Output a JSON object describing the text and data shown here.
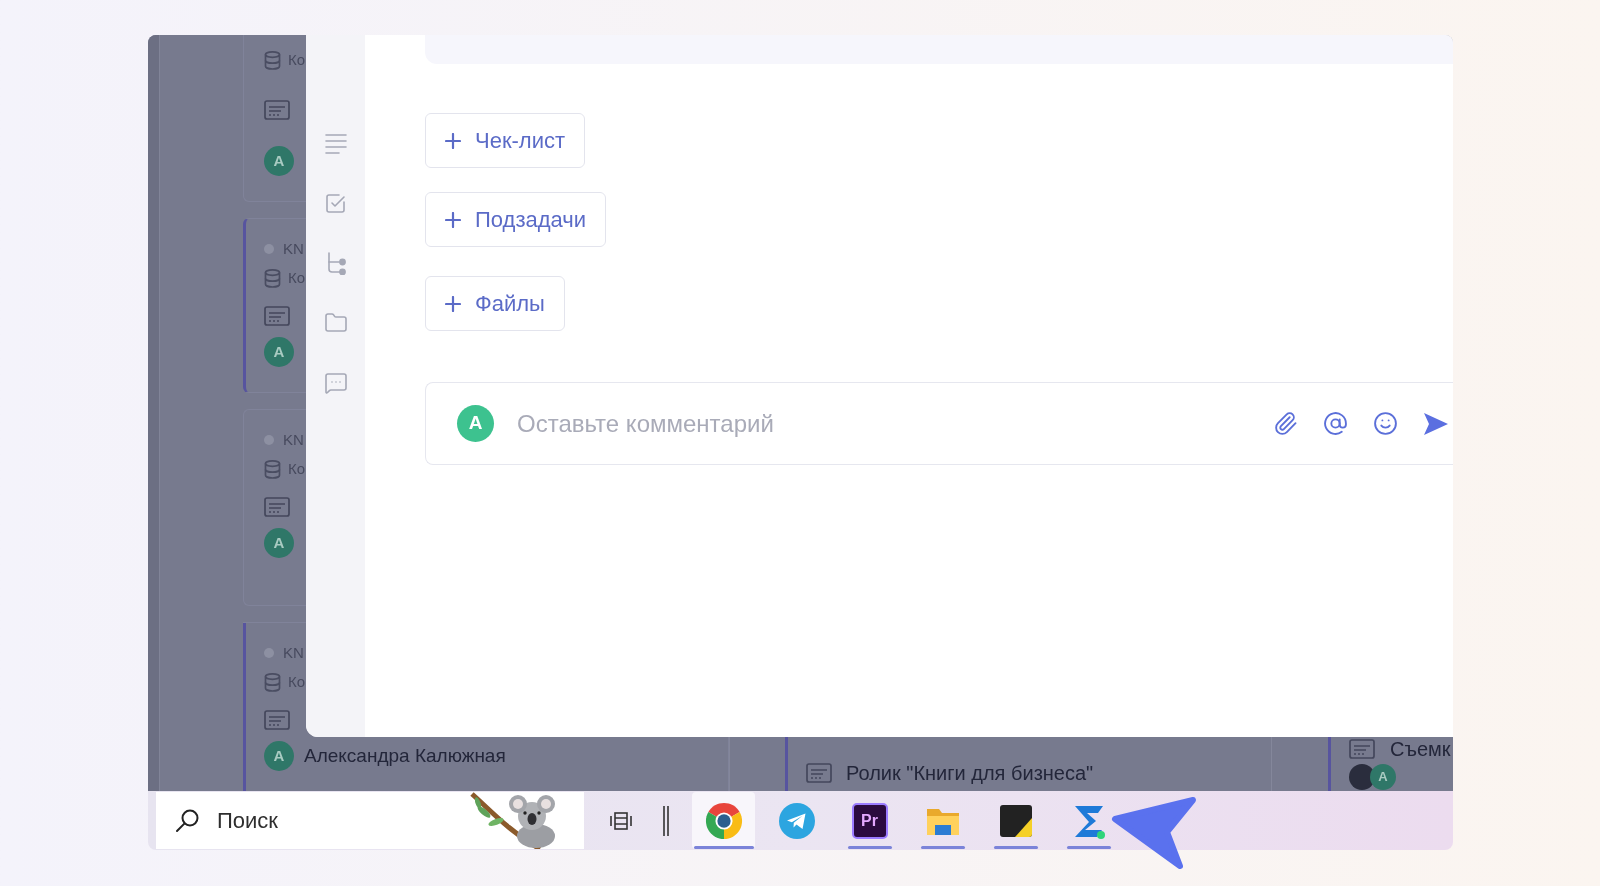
{
  "board": {
    "column_1": [
      {
        "marked": false,
        "project": "Ко",
        "avatar": "А"
      },
      {
        "marked": true,
        "code": "KN",
        "project": "Ко",
        "avatar": "А"
      },
      {
        "marked": false,
        "code": "KN",
        "project": "Ко",
        "avatar": "А"
      },
      {
        "marked": true,
        "code": "KN",
        "project": "Ко",
        "avatar": "А",
        "assignee": "Александра Калюжная"
      }
    ],
    "column_2": [
      {
        "marked": true,
        "title": "Ролик \"Книги для бизнеса\""
      }
    ],
    "column_3": [
      {
        "marked": true,
        "title": "Съемк",
        "avatars": [
          {
            "kind": "photo"
          },
          {
            "kind": "letter",
            "letter": "А"
          }
        ]
      }
    ]
  },
  "task_panel": {
    "add_buttons": [
      {
        "label": "Чек-лист"
      },
      {
        "label": "Подзадачи"
      },
      {
        "label": "Файлы"
      }
    ],
    "comment": {
      "avatar": "А",
      "placeholder": "Оставьте комментарий"
    }
  },
  "taskbar": {
    "search": {
      "placeholder": "Поиск"
    },
    "buttons": [
      {
        "kind": "task-view"
      },
      {
        "kind": "bars"
      }
    ],
    "apps": [
      {
        "kind": "browser",
        "selected": true,
        "running": true
      },
      {
        "kind": "messenger",
        "selected": false,
        "running": false
      },
      {
        "kind": "video-editor",
        "label": "Pr",
        "selected": false,
        "running": true
      },
      {
        "kind": "files",
        "selected": false,
        "running": true
      },
      {
        "kind": "notes",
        "selected": false,
        "running": true
      },
      {
        "kind": "tracker",
        "selected": false,
        "running": true
      }
    ]
  }
}
